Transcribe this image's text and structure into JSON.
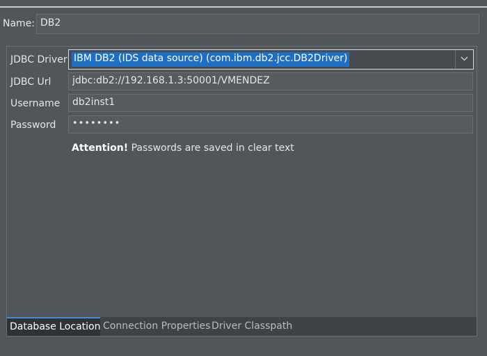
{
  "connection": {
    "name_label": "Name:",
    "name_value": "DB2"
  },
  "form": {
    "driver_label": "JDBC Driver",
    "driver_value": "IBM DB2 (IDS data source) (com.ibm.db2.jcc.DB2Driver)",
    "url_label": "JDBC Url",
    "url_value": "jdbc:db2://192.168.1.3:50001/VMENDEZ",
    "username_label": "Username",
    "username_value": "db2inst1",
    "password_label": "Password",
    "password_value": "••••••••",
    "attention_strong": "Attention!",
    "attention_text": " Passwords are saved in clear text"
  },
  "tabs": [
    {
      "label": "Database Location",
      "active": true
    },
    {
      "label": "Connection Properties",
      "active": false
    },
    {
      "label": "Driver Classpath",
      "active": false
    }
  ],
  "colors": {
    "background": "#50565a",
    "selection": "#1e6fc4",
    "tab_accent": "#3a8fd6"
  },
  "icons": {
    "dropdown": "chevron-down-icon"
  }
}
